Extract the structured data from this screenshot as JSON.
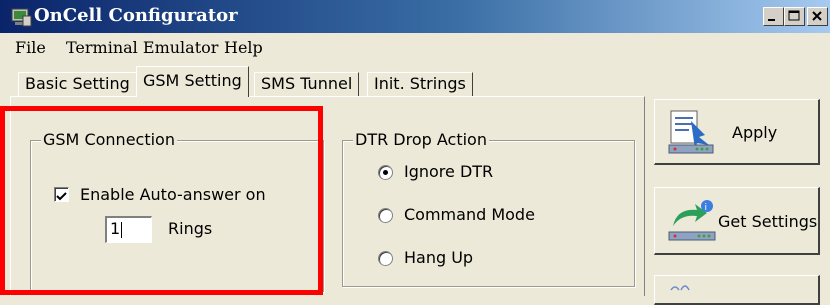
{
  "window": {
    "title": "OnCell Configurator"
  },
  "icons": {
    "app": "configurator-app-icon",
    "minimize": "minimize-icon",
    "maximize": "maximize-icon",
    "close": "close-icon",
    "apply": "apply-icon",
    "get_settings": "get-settings-icon"
  },
  "menu": {
    "items": [
      {
        "label": "File"
      },
      {
        "label": "Terminal Emulator"
      },
      {
        "label": "Help"
      }
    ]
  },
  "tabs": [
    {
      "label": "Basic Setting"
    },
    {
      "label": "GSM Setting",
      "active": true
    },
    {
      "label": "SMS Tunnel"
    },
    {
      "label": "Init. Strings"
    }
  ],
  "gsm_connection": {
    "title": "GSM Connection",
    "auto_answer_label": "Enable Auto-answer on",
    "auto_answer_checked": true,
    "rings_value": "1",
    "rings_label": "Rings"
  },
  "dtr_drop_action": {
    "title": "DTR Drop Action",
    "selected": "Ignore DTR",
    "options": [
      {
        "label": "Ignore DTR"
      },
      {
        "label": "Command Mode"
      },
      {
        "label": "Hang Up"
      }
    ]
  },
  "buttons": {
    "apply": "Apply",
    "get_settings": "Get Settings"
  },
  "colors": {
    "highlight": "#ff0000",
    "titlebar_start": "#0a246a",
    "titlebar_end": "#a6caf0",
    "face": "#ece9d8"
  }
}
